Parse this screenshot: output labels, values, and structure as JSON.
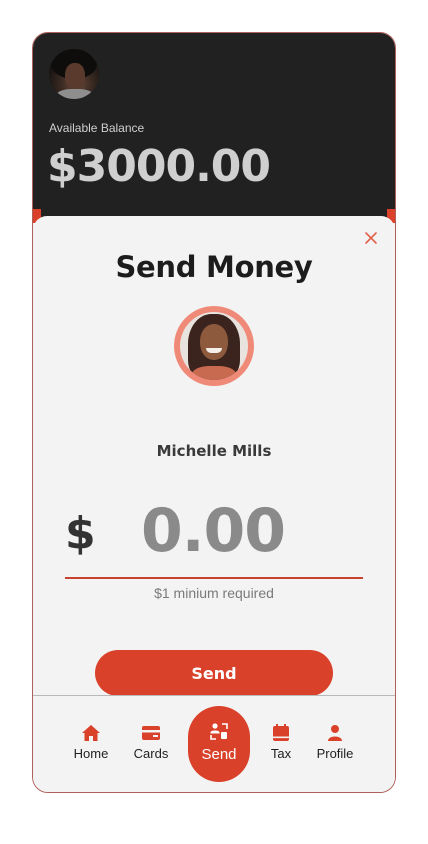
{
  "header": {
    "balance_label": "Available Balance",
    "balance_value": "$3000.00"
  },
  "modal": {
    "title": "Send Money",
    "recipient_name": "Michelle Mills",
    "currency_symbol": "$",
    "amount_placeholder": "0.00",
    "amount_hint": "$1 minium required",
    "send_label": "Send"
  },
  "nav": {
    "items": [
      {
        "label": "Home",
        "icon": "home-icon"
      },
      {
        "label": "Cards",
        "icon": "card-icon"
      },
      {
        "label": "Send",
        "icon": "send-money-icon",
        "active": true
      },
      {
        "label": "Tax",
        "icon": "calendar-icon"
      },
      {
        "label": "Profile",
        "icon": "profile-icon"
      }
    ]
  },
  "colors": {
    "accent": "#d9412a",
    "header_bg": "#212121",
    "surface": "#f3f3f3"
  }
}
